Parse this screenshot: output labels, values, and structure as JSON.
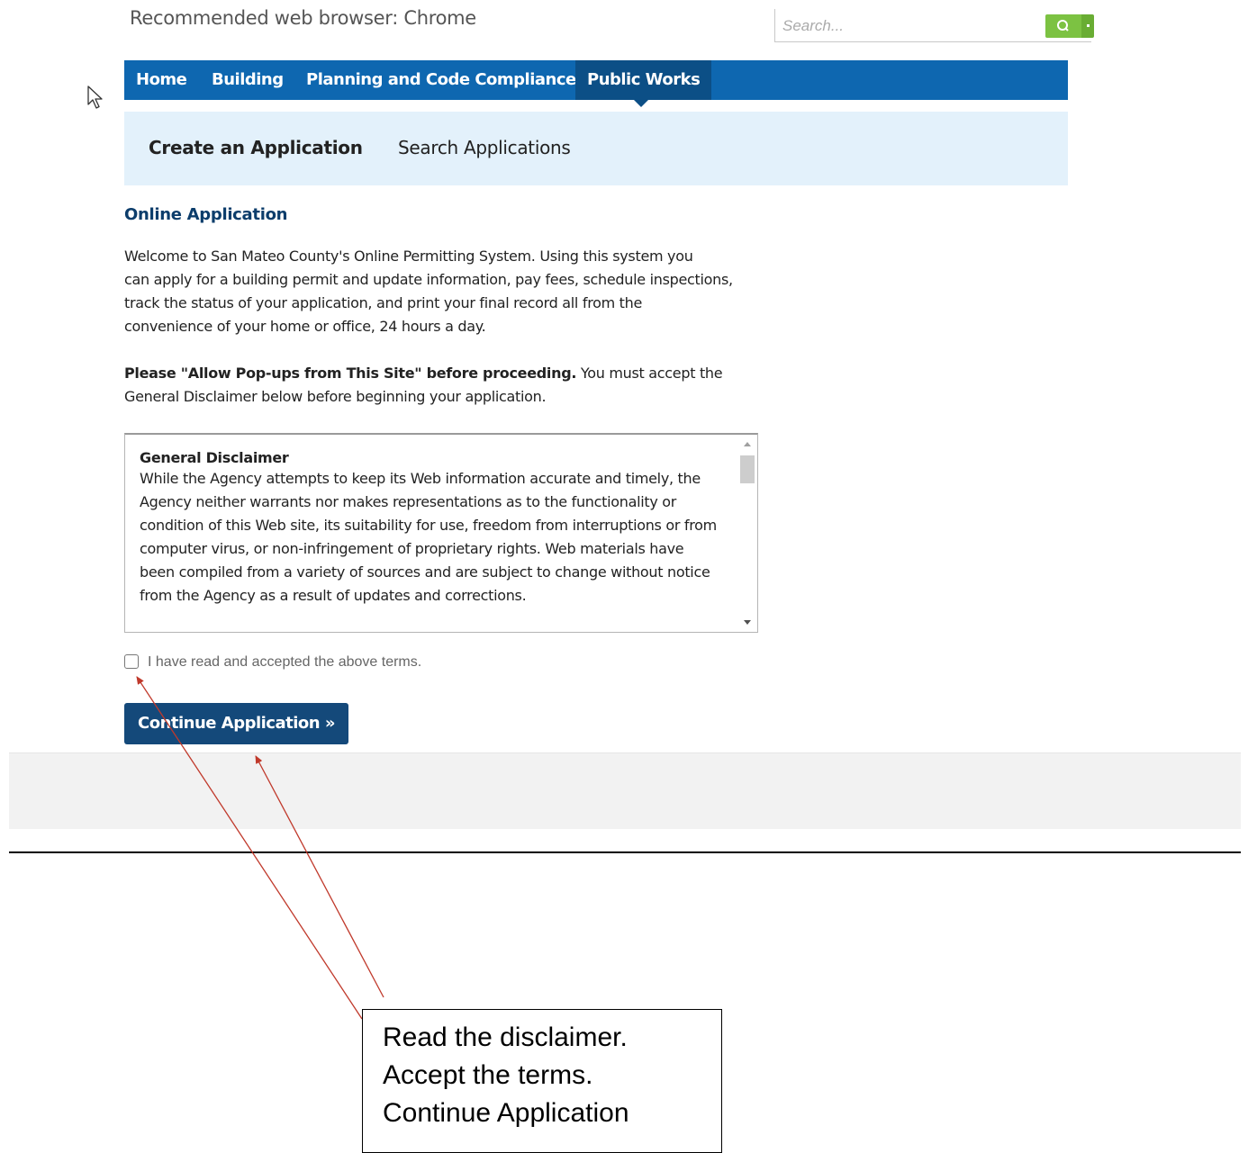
{
  "header": {
    "browser_note": "Recommended web browser: Chrome",
    "search_placeholder": "Search..."
  },
  "nav": {
    "items": [
      "Home",
      "Building",
      "Planning and Code Compliance",
      "Public Works"
    ],
    "active": "Public Works"
  },
  "subnav": {
    "create": "Create an Application",
    "search": "Search Applications"
  },
  "content": {
    "title": "Online Application",
    "intro_lines": [
      "Welcome to San Mateo County's Online Permitting System. Using this system you",
      "can apply for a building permit and update information, pay fees, schedule inspections,",
      "track the status of your application, and print your final record all from the",
      "convenience of your home or office, 24 hours a day."
    ],
    "popup_bold": "Please \"Allow Pop-ups from This Site\" before proceeding.",
    "popup_rest": " You must accept the",
    "popup_line2": "General Disclaimer below before beginning your application."
  },
  "disclaimer": {
    "title": "General Disclaimer",
    "lines": [
      "While the Agency attempts to keep its Web information accurate and timely, the",
      "Agency neither warrants nor makes representations as to the functionality or",
      "condition of this Web site, its suitability for use, freedom from interruptions or from",
      "computer virus, or non-infringement of proprietary rights. Web materials have",
      "been compiled from a variety of sources and are subject to change without notice",
      "from the Agency as a result of updates and corrections."
    ]
  },
  "accept_label": "I have read and accepted the above terms.",
  "continue_label": "Continue Application »",
  "callout": {
    "lines": [
      "Read the disclaimer.",
      "Accept the terms.",
      "Continue Application"
    ]
  },
  "colors": {
    "nav_bg": "#0e67b0",
    "nav_active": "#0c4f86",
    "subnav_bg": "#e3f1fb",
    "button_bg": "#14497a",
    "search_btn": "#7cc242",
    "arrow": "#c0392b"
  }
}
